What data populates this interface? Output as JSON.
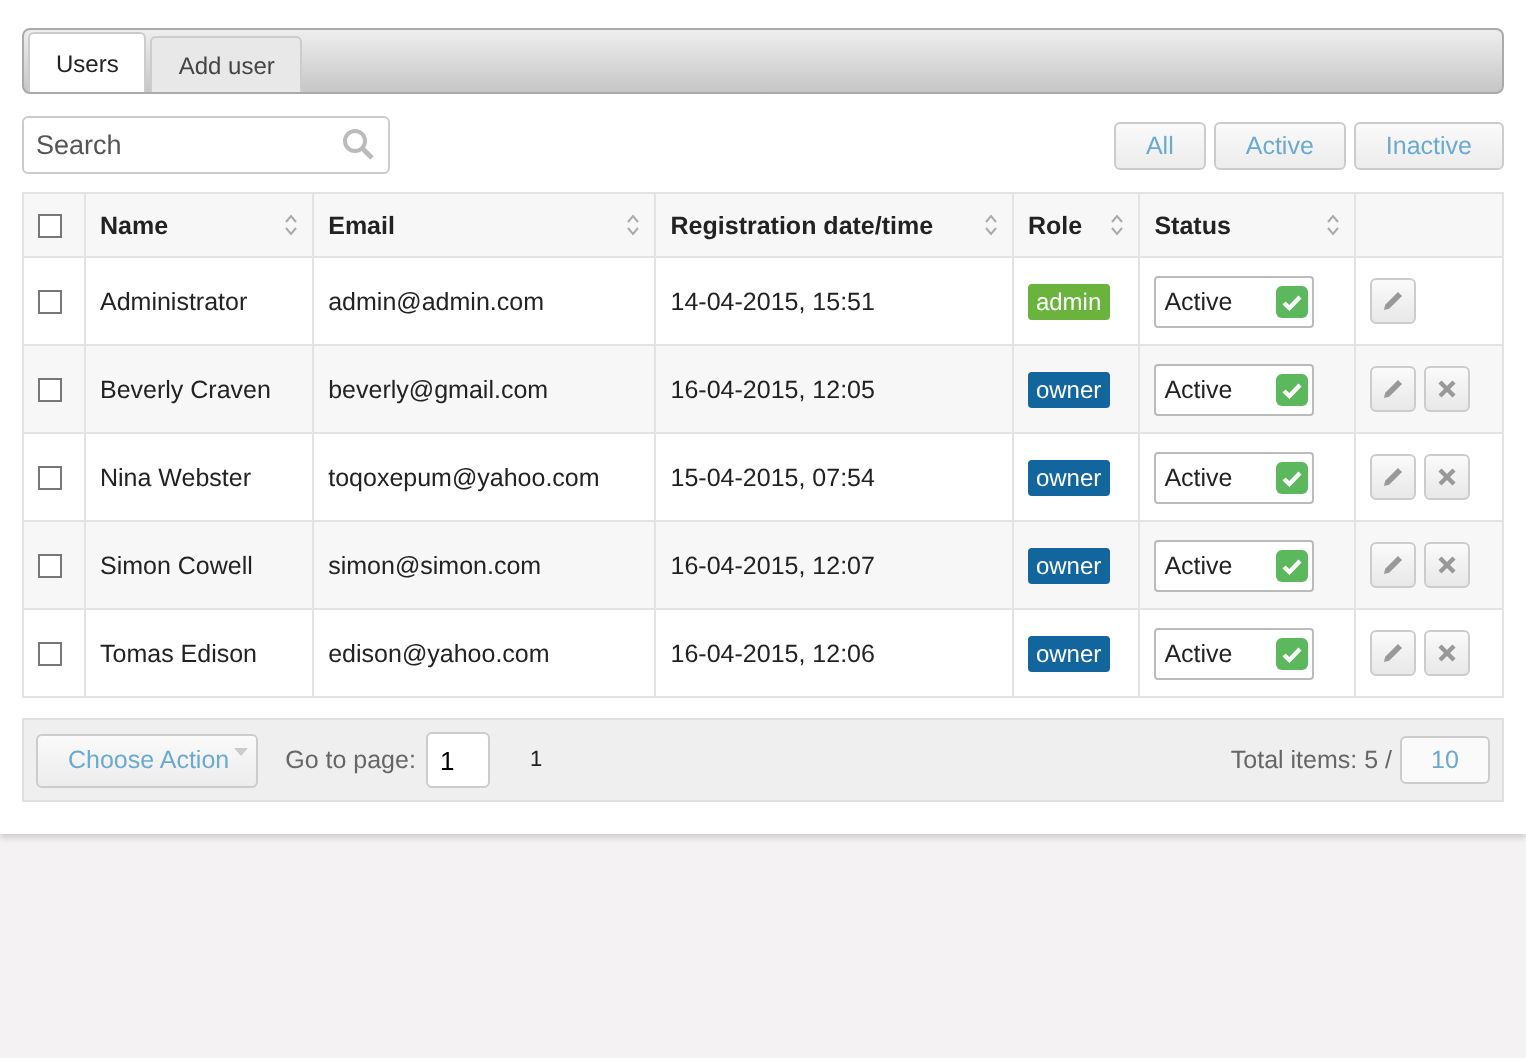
{
  "tabs": [
    {
      "label": "Users",
      "selected": true
    },
    {
      "label": "Add user",
      "selected": false
    }
  ],
  "search": {
    "placeholder": "Search"
  },
  "filters": [
    {
      "label": "All",
      "selected": false
    },
    {
      "label": "Active",
      "selected": false
    },
    {
      "label": "Inactive",
      "selected": false
    }
  ],
  "table": {
    "select_all": {
      "checked": false
    },
    "columns": [
      "Name",
      "Email",
      "Registration date/time",
      "Role",
      "Status"
    ],
    "rows": [
      {
        "checked": false,
        "name": "Administrator",
        "email": "admin@admin.com",
        "registered": "14-04-2015, 15:51",
        "role": "admin",
        "color": "#6ab43e",
        "status": "Active",
        "active": true,
        "actions": [
          {
            "kind": "edit"
          }
        ]
      },
      {
        "checked": false,
        "name": "Beverly Craven",
        "email": "beverly@gmail.com",
        "registered": "16-04-2015, 12:05",
        "role": "owner",
        "color": "#13659e",
        "status": "Active",
        "active": true,
        "actions": [
          {
            "kind": "edit"
          },
          {
            "kind": "delete"
          }
        ]
      },
      {
        "checked": false,
        "name": "Nina Webster",
        "email": "toqoxepum@yahoo.com",
        "registered": "15-04-2015, 07:54",
        "role": "owner",
        "color": "#13659e",
        "status": "Active",
        "active": true,
        "actions": [
          {
            "kind": "edit"
          },
          {
            "kind": "delete"
          }
        ]
      },
      {
        "checked": false,
        "name": "Simon Cowell",
        "email": "simon@simon.com",
        "registered": "16-04-2015, 12:07",
        "role": "owner",
        "color": "#13659e",
        "status": "Active",
        "active": true,
        "actions": [
          {
            "kind": "edit"
          },
          {
            "kind": "delete"
          }
        ]
      },
      {
        "checked": false,
        "name": "Tomas Edison",
        "email": "edison@yahoo.com",
        "registered": "16-04-2015, 12:06",
        "role": "owner",
        "color": "#13659e",
        "status": "Active",
        "active": true,
        "actions": [
          {
            "kind": "edit"
          },
          {
            "kind": "delete"
          }
        ]
      }
    ]
  },
  "footer": {
    "action_button": "Choose Action",
    "goto_label": "Go to page:",
    "page_value": "1",
    "pages": [
      "1"
    ],
    "total_label": "Total items: 5 /",
    "page_size": "10"
  }
}
